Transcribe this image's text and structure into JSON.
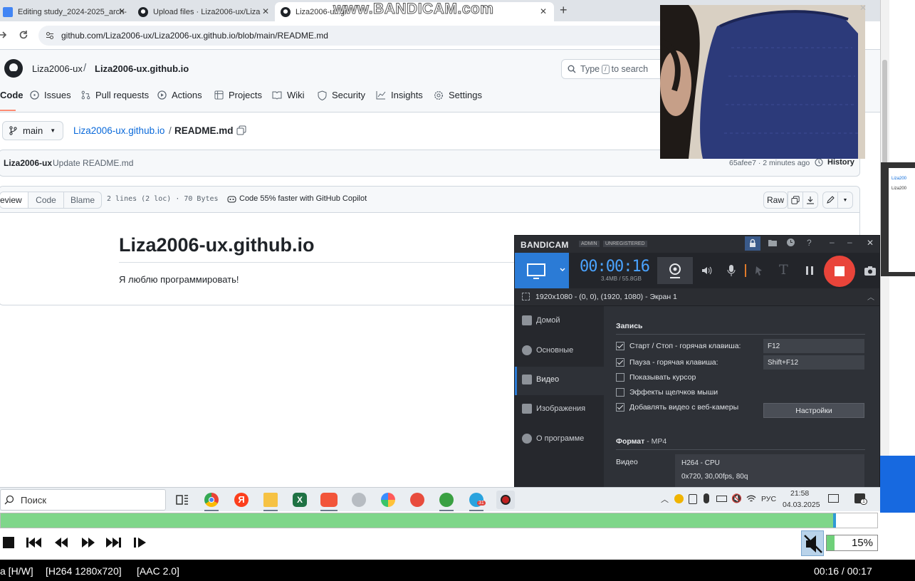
{
  "browser": {
    "tabs": [
      {
        "label": "Editing study_2024-2025_arch-",
        "close": "✕"
      },
      {
        "label": "Upload files · Liza2006-ux/Liza",
        "close": "✕"
      },
      {
        "label": "Liza2006-ux.gi",
        "close": "✕"
      }
    ],
    "new_tab": "+",
    "url": "github.com/Liza2006-ux/Liza2006-ux.github.io/blob/main/README.md",
    "watermark": "www.BANDICAM.com"
  },
  "github": {
    "owner": "Liza2006-ux",
    "separator": "/",
    "repo": "Liza2006-ux.github.io",
    "search_prefix": "Type",
    "search_key": "/",
    "search_suffix": "to search",
    "nav": [
      "Code",
      "Issues",
      "Pull requests",
      "Actions",
      "Projects",
      "Wiki",
      "Security",
      "Insights",
      "Settings"
    ],
    "branch": "main",
    "breadcrumb_repo": "Liza2006-ux.github.io",
    "breadcrumb_sep": "/",
    "breadcrumb_file": "README.md",
    "commit_author": "Liza2006-ux",
    "commit_message": "Update README.md",
    "commit_meta": "65afee7 · 2 minutes ago",
    "history": "History",
    "view_tabs": [
      "eview",
      "Code",
      "Blame"
    ],
    "file_info": "2 lines (2 loc) · 70 Bytes",
    "copilot": "Code 55% faster with GitHub Copilot",
    "raw": "Raw",
    "readme_title": "Liza2006-ux.github.io",
    "readme_text": "Я люблю программировать!"
  },
  "bandicam": {
    "logo": "BANDICAM",
    "badge_admin": "ADMIN",
    "badge_unreg": "UNREGISTERED",
    "help": "?",
    "minimize": "–",
    "close": "✕",
    "timer": "00:00:16",
    "size": "3.4MB / 55.8GB",
    "text_tool": "T",
    "resolution": "1920x1080 - (0, 0), (1920, 1080) - Экран 1",
    "sidebar": [
      "Домой",
      "Основные",
      "Видео",
      "Изображения",
      "О программе"
    ],
    "section_title": "Запись",
    "options": [
      {
        "label": "Старт / Стоп - горячая клавиша:",
        "checked": true
      },
      {
        "label": "Пауза - горячая клавиша:",
        "checked": true
      },
      {
        "label": "Показывать курсор",
        "checked": false
      },
      {
        "label": "Эффекты щелчков мыши",
        "checked": false
      },
      {
        "label": "Добавлять видео с веб-камеры",
        "checked": true
      }
    ],
    "hotkey_start": "F12",
    "hotkey_pause": "Shift+F12",
    "settings_button": "Настройки",
    "format_label": "Формат",
    "format_value": "- MP4",
    "video_label": "Видео",
    "video_codec": "H264 - CPU",
    "video_params": "0x720, 30,00fps, 80q"
  },
  "taskbar": {
    "search": "Поиск",
    "lang": "РУС",
    "time": "21:58",
    "date": "04.03.2025",
    "telegram_badge": "31",
    "notif_badge": "1"
  },
  "player": {
    "progress": 0.95,
    "volume": "15%",
    "status_left": "a [H/W]",
    "video_info": "[H264 1280x720]",
    "audio_info": "[AAC 2.0]",
    "time": "00:16 / 00:17"
  },
  "right_window": {
    "line1": "Liza200",
    "line2": "Liza200"
  }
}
